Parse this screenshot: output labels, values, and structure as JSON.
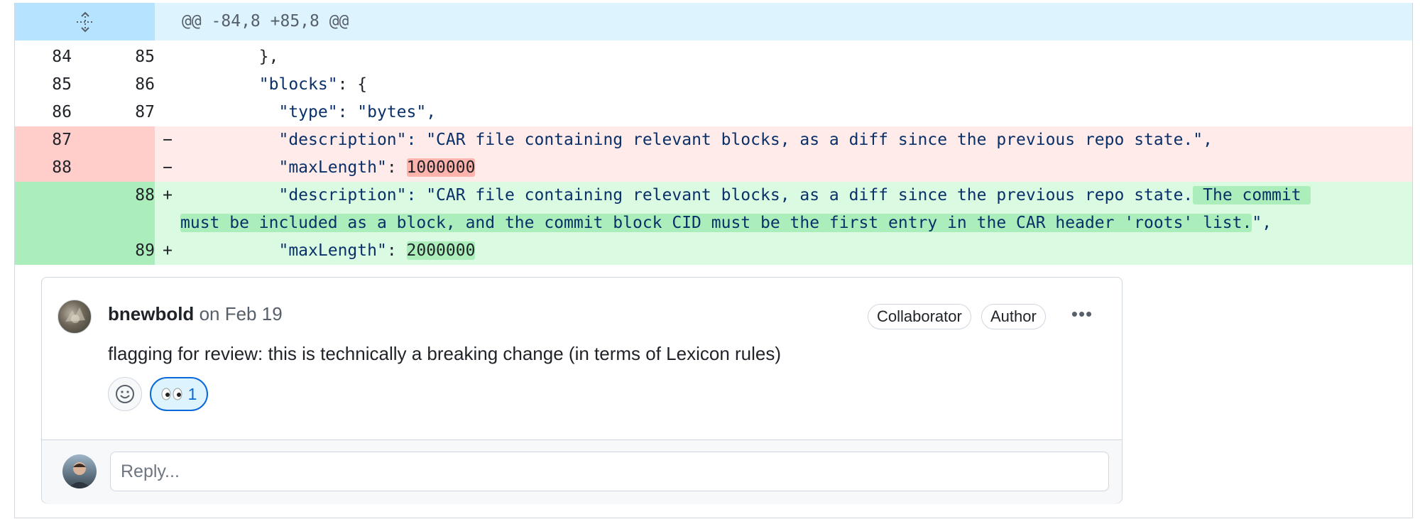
{
  "hunk": {
    "header": "@@ -84,8 +85,8 @@"
  },
  "lines": {
    "l1": {
      "old": "84",
      "new": "85",
      "code": "        },"
    },
    "l2": {
      "old": "85",
      "new": "86",
      "key": "\"blocks\"",
      "rest": ": {"
    },
    "l3": {
      "old": "86",
      "new": "87",
      "key": "\"type\"",
      "rest": ": \"bytes\","
    },
    "d1": {
      "old": "87",
      "sign": "−",
      "key": "\"description\"",
      "rest": ": \"CAR file containing relevant blocks, as a diff since the previous repo state.\","
    },
    "d2": {
      "old": "88",
      "sign": "−",
      "key": "\"maxLength\"",
      "sep": ": ",
      "val": "1000000"
    },
    "a1": {
      "new": "88",
      "sign": "+",
      "key": "\"description\"",
      "rest": ": \"CAR file containing relevant blocks, as a diff since the previous repo state.",
      "hl1": " The commit ",
      "cont": "must be included as a block, and the commit block CID must be the first entry in the CAR header 'roots' list.",
      "tail": "\","
    },
    "a2": {
      "new": "89",
      "sign": "+",
      "key": "\"maxLength\"",
      "sep": ": ",
      "val": "2000000"
    }
  },
  "comment": {
    "author": "bnewbold",
    "date": "on Feb 19",
    "badges": {
      "collaborator": "Collaborator",
      "author": "Author"
    },
    "more_label": "•••",
    "body": "flagging for review: this is technically a breaking change (in terms of Lexicon rules)",
    "reaction": {
      "emoji": "👀",
      "count": "1"
    }
  },
  "reply": {
    "placeholder": "Reply..."
  }
}
